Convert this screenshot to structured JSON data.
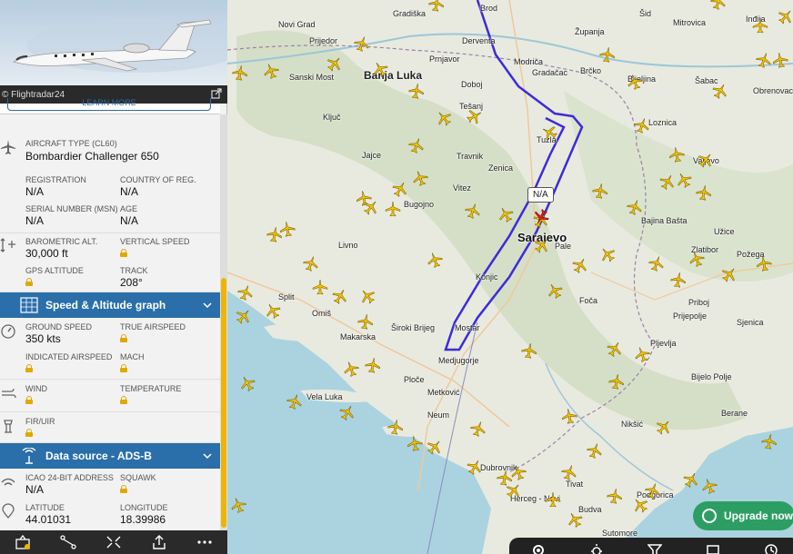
{
  "photo": {
    "credit": "© Flightradar24",
    "learn_more": "LEARN MORE"
  },
  "aircraft": {
    "type_label": "AIRCRAFT TYPE (CL60)",
    "type_value": "Bombardier Challenger 650",
    "registration_label": "REGISTRATION",
    "registration_value": "N/A",
    "country_label": "COUNTRY OF REG.",
    "country_value": "N/A",
    "serial_label": "SERIAL NUMBER (MSN)",
    "serial_value": "N/A",
    "age_label": "AGE",
    "age_value": "N/A"
  },
  "altitude": {
    "baro_label": "BAROMETRIC ALT.",
    "baro_value": "30,000 ft",
    "vs_label": "VERTICAL SPEED",
    "gps_label": "GPS ALTITUDE",
    "track_label": "TRACK",
    "track_value": "208°"
  },
  "speed_header": "Speed & Altitude graph",
  "speed": {
    "gs_label": "GROUND SPEED",
    "gs_value": "350 kts",
    "tas_label": "TRUE AIRSPEED",
    "ias_label": "INDICATED AIRSPEED",
    "mach_label": "MACH"
  },
  "weather": {
    "wind_label": "WIND",
    "temp_label": "TEMPERATURE"
  },
  "fir": {
    "label": "FIR/UIR"
  },
  "source_header": "Data source - ADS-B",
  "source": {
    "icao_label": "ICAO 24-BIT ADDRESS",
    "icao_value": "N/A",
    "squawk_label": "SQUAWK",
    "lat_label": "LATITUDE",
    "lat_value": "44.01031",
    "lon_label": "LONGITUDE",
    "lon_value": "18.39986"
  },
  "map": {
    "track_color": "#3d2bd9",
    "plane_color": "#f5c400",
    "selected_label": "N/A",
    "upgrade": "Upgrade now",
    "cities": [
      {
        "name": "Gradiška",
        "cls": ""
      },
      {
        "name": "Novi Grad",
        "cls": ""
      },
      {
        "name": "Prijedor",
        "cls": ""
      },
      {
        "name": "Prnjavor",
        "cls": ""
      },
      {
        "name": "Banja Luka",
        "cls": "big"
      },
      {
        "name": "Sanski Most",
        "cls": ""
      },
      {
        "name": "Ključ",
        "cls": ""
      },
      {
        "name": "Jajce",
        "cls": ""
      },
      {
        "name": "Travnik",
        "cls": ""
      },
      {
        "name": "Bugojno",
        "cls": ""
      },
      {
        "name": "Livno",
        "cls": ""
      },
      {
        "name": "Split",
        "cls": ""
      },
      {
        "name": "Omiš",
        "cls": ""
      },
      {
        "name": "Makarska",
        "cls": ""
      },
      {
        "name": "Vela Luka",
        "cls": ""
      },
      {
        "name": "Mostar",
        "cls": ""
      },
      {
        "name": "Medjugorje",
        "cls": ""
      },
      {
        "name": "Široki Brijeg",
        "cls": ""
      },
      {
        "name": "Ploče",
        "cls": ""
      },
      {
        "name": "Metković",
        "cls": ""
      },
      {
        "name": "Neum",
        "cls": ""
      },
      {
        "name": "Dubrovnik",
        "cls": ""
      },
      {
        "name": "Sarajevo",
        "cls": "sar"
      },
      {
        "name": "Pale",
        "cls": ""
      },
      {
        "name": "Konjic",
        "cls": ""
      },
      {
        "name": "Zenica",
        "cls": ""
      },
      {
        "name": "Vitez",
        "cls": ""
      },
      {
        "name": "Tuzla",
        "cls": ""
      },
      {
        "name": "Doboj",
        "cls": ""
      },
      {
        "name": "Derventa",
        "cls": ""
      },
      {
        "name": "Modriča",
        "cls": ""
      },
      {
        "name": "Gradačac",
        "cls": ""
      },
      {
        "name": "Brčko",
        "cls": ""
      },
      {
        "name": "Županja",
        "cls": ""
      },
      {
        "name": "Brod",
        "cls": ""
      },
      {
        "name": "Tešanj",
        "cls": ""
      },
      {
        "name": "Bijeljina",
        "cls": ""
      },
      {
        "name": "Šid",
        "cls": ""
      },
      {
        "name": "Šabac",
        "cls": ""
      },
      {
        "name": "Loznica",
        "cls": ""
      },
      {
        "name": "Valjevo",
        "cls": ""
      },
      {
        "name": "Bajina Bašta",
        "cls": ""
      },
      {
        "name": "Užice",
        "cls": ""
      },
      {
        "name": "Zlatibor",
        "cls": ""
      },
      {
        "name": "Priboj",
        "cls": ""
      },
      {
        "name": "Prijepolje",
        "cls": ""
      },
      {
        "name": "Pljevlja",
        "cls": ""
      },
      {
        "name": "Foča",
        "cls": ""
      },
      {
        "name": "Bijelo Polje",
        "cls": ""
      },
      {
        "name": "Berane",
        "cls": ""
      },
      {
        "name": "Nikšić",
        "cls": ""
      },
      {
        "name": "Herceg - Novi",
        "cls": ""
      },
      {
        "name": "Tivat",
        "cls": ""
      },
      {
        "name": "Budva",
        "cls": ""
      },
      {
        "name": "Podgorica",
        "cls": ""
      },
      {
        "name": "Sutomore",
        "cls": ""
      },
      {
        "name": "Požega",
        "cls": ""
      },
      {
        "name": "Sjenica",
        "cls": ""
      },
      {
        "name": "Obrenovac",
        "cls": ""
      },
      {
        "name": "Mitrovica",
        "cls": ""
      },
      {
        "name": "Inđija",
        "cls": ""
      }
    ]
  }
}
